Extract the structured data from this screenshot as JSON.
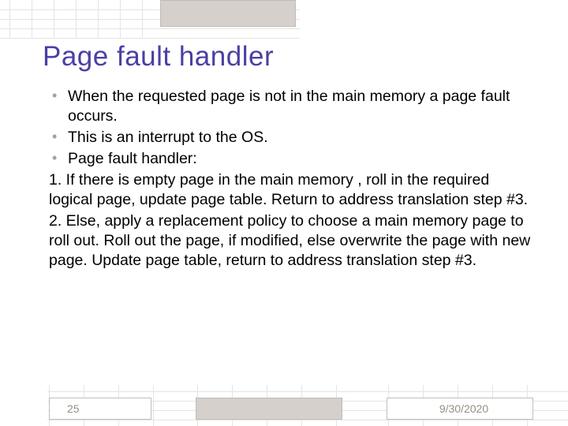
{
  "title": "Page fault handler",
  "bullets": [
    "When the requested page is not in the main memory a page fault occurs.",
    "This is an interrupt to the OS.",
    "Page fault handler:"
  ],
  "numbered": [
    "1. If there is empty page in the main memory , roll in the required logical page, update page table. Return to address translation step #3.",
    "2. Else, apply a replacement policy to choose a main memory page to roll out. Roll out the page, if modified, else overwrite the page with new page. Update page table, return to address translation step #3."
  ],
  "footer": {
    "slide_number": "25",
    "date": "9/30/2020"
  }
}
